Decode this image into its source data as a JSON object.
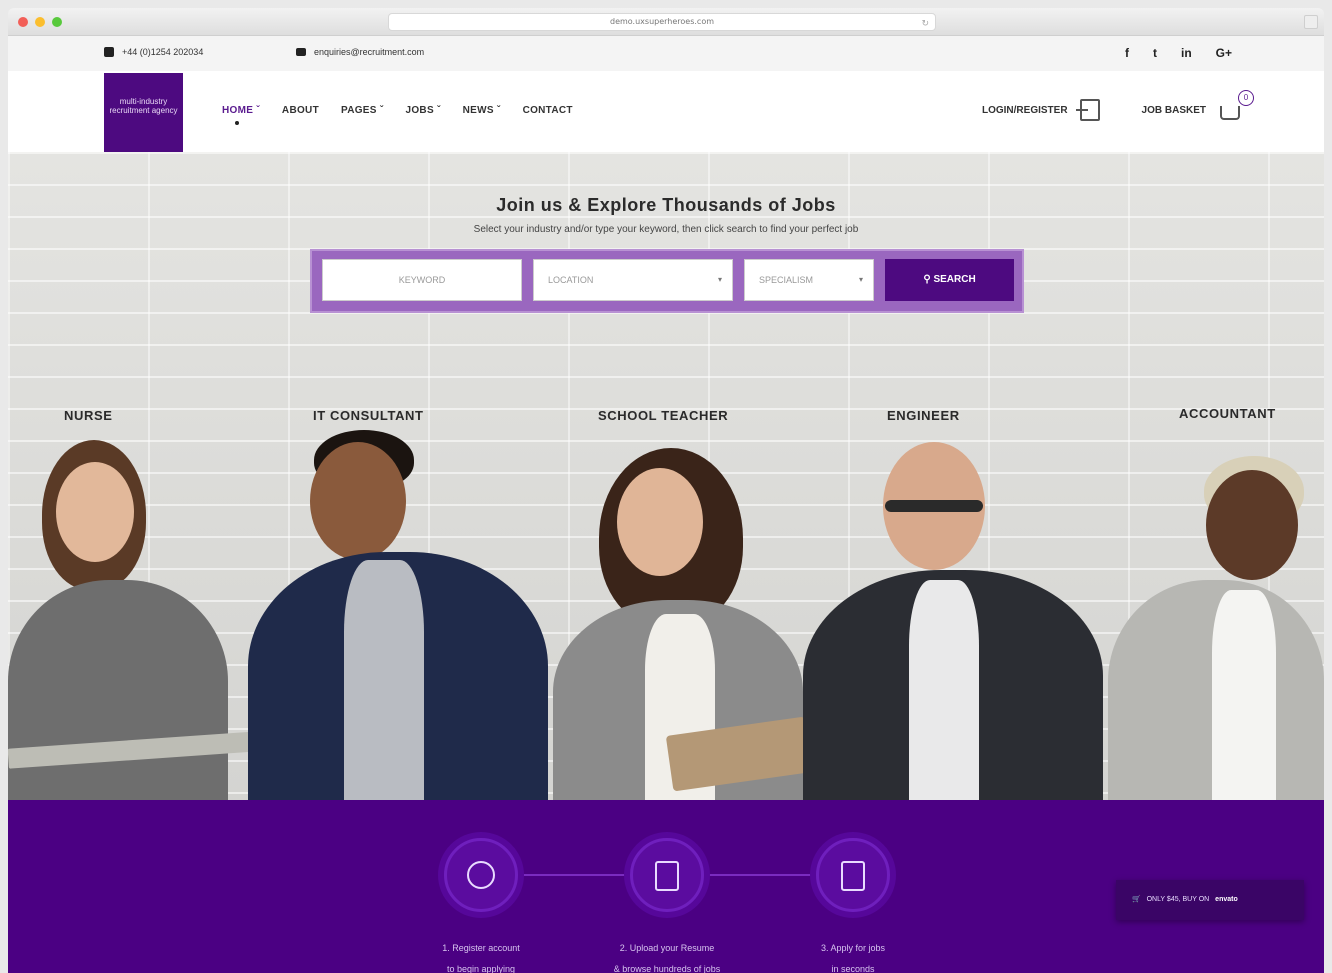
{
  "browser": {
    "url": "demo.uxsuperheroes.com"
  },
  "topbar": {
    "phone": "+44 (0)1254 202034",
    "email": "enquiries@recruitment.com",
    "socials": [
      "f",
      "t",
      "in",
      "G+"
    ]
  },
  "logo": {
    "text": "multi-industry recruitment agency"
  },
  "nav": {
    "items": [
      {
        "label": "HOME"
      },
      {
        "label": "ABOUT"
      },
      {
        "label": "PAGES"
      },
      {
        "label": "JOBS"
      },
      {
        "label": "NEWS"
      },
      {
        "label": "CONTACT"
      }
    ],
    "login_label": "LOGIN/REGISTER",
    "basket_label": "JOB BASKET",
    "basket_count": "0"
  },
  "hero": {
    "title": "Join us & Explore Thousands of Jobs",
    "subtitle": "Select your industry and/or type your keyword, then click search to find your perfect job",
    "search": {
      "keyword_placeholder": "KEYWORD",
      "location_placeholder": "LOCATION",
      "specialism_placeholder": "SPECIALISM",
      "button_label": "SEARCH"
    },
    "roles": [
      "NURSE",
      "IT CONSULTANT",
      "SCHOOL TEACHER",
      "ENGINEER",
      "ACCOUNTANT"
    ]
  },
  "steps": [
    {
      "line1": "1. Register account",
      "line2": "to begin applying"
    },
    {
      "line1": "2. Upload your Resume",
      "line2": "& browse hundreds of jobs"
    },
    {
      "line1": "3. Apply for jobs",
      "line2": "in seconds"
    }
  ],
  "envato": {
    "text": "ONLY $45, BUY ON",
    "brand": "envato"
  },
  "colors": {
    "brand_purple": "#4d0a80",
    "band_purple": "#4b0083",
    "search_frame": "#9a67bf"
  }
}
